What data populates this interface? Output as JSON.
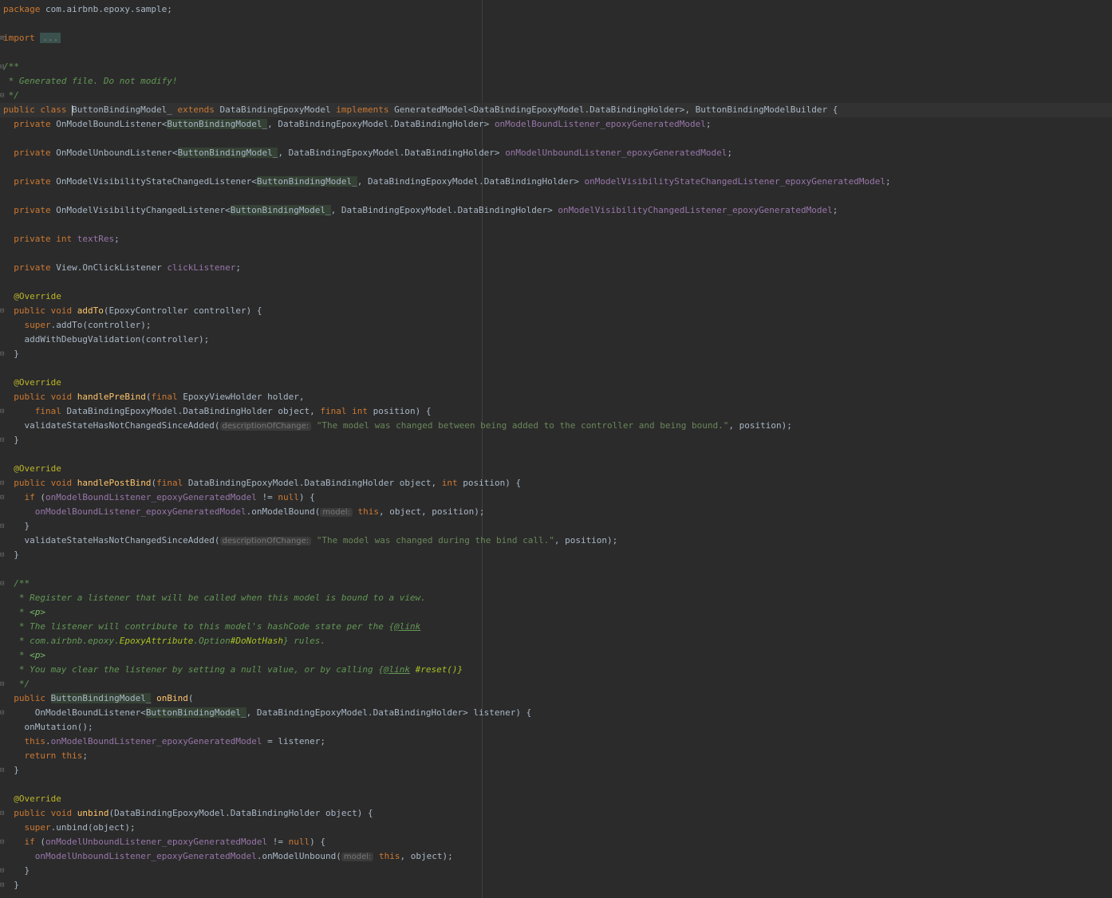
{
  "colors": {
    "background": "#2b2b2b",
    "text": "#a9b7c6",
    "keyword": "#cc7832",
    "annotation": "#bbb529",
    "field": "#9876aa",
    "method": "#ffc66d",
    "string": "#6a8759",
    "doc_comment": "#629755"
  },
  "editor": {
    "lines": [
      {
        "segments": [
          {
            "t": "package",
            "c": "kw"
          },
          {
            "t": " com.airbnb.epoxy.sample;"
          }
        ]
      },
      {
        "segments": []
      },
      {
        "fold": "⊞",
        "segments": [
          {
            "t": "import",
            "c": "kw"
          },
          {
            "t": " "
          },
          {
            "t": "...",
            "c": "fold-dots"
          }
        ]
      },
      {
        "segments": []
      },
      {
        "fold": "⊟",
        "segments": [
          {
            "t": "/**",
            "c": "cmt"
          }
        ]
      },
      {
        "segments": [
          {
            "t": " * Generated file. Do not modify!",
            "c": "cmt"
          }
        ]
      },
      {
        "fold": "⊟",
        "segments": [
          {
            "t": " */",
            "c": "cmt"
          }
        ]
      },
      {
        "current": true,
        "segments": [
          {
            "t": "public class ",
            "c": "kw"
          },
          {
            "caret": true
          },
          {
            "t": "ButtonBindingModel_"
          },
          {
            "t": " extends ",
            "c": "kw"
          },
          {
            "t": "DataBindingEpoxyModel"
          },
          {
            "t": " implements ",
            "c": "kw"
          },
          {
            "t": "GeneratedModel<DataBindingEpoxyModel.DataBindingHolder>, ButtonBindingModelBuilder {"
          }
        ]
      },
      {
        "segments": [
          {
            "t": "  "
          },
          {
            "t": "private ",
            "c": "kw"
          },
          {
            "t": "OnModelBoundListener<"
          },
          {
            "t": "ButtonBindingModel_",
            "c": "hl"
          },
          {
            "t": ", DataBindingEpoxyModel.DataBindingHolder> "
          },
          {
            "t": "onModelBoundListener_epoxyGeneratedModel",
            "c": "fld"
          },
          {
            "t": ";"
          }
        ]
      },
      {
        "segments": []
      },
      {
        "segments": [
          {
            "t": "  "
          },
          {
            "t": "private ",
            "c": "kw"
          },
          {
            "t": "OnModelUnboundListener<"
          },
          {
            "t": "ButtonBindingModel_",
            "c": "hl"
          },
          {
            "t": ", DataBindingEpoxyModel.DataBindingHolder> "
          },
          {
            "t": "onModelUnboundListener_epoxyGeneratedModel",
            "c": "fld"
          },
          {
            "t": ";"
          }
        ]
      },
      {
        "segments": []
      },
      {
        "segments": [
          {
            "t": "  "
          },
          {
            "t": "private ",
            "c": "kw"
          },
          {
            "t": "OnModelVisibilityStateChangedListener<"
          },
          {
            "t": "ButtonBindingModel_",
            "c": "hl"
          },
          {
            "t": ", DataBindingEpoxyModel.DataBindingHolder> "
          },
          {
            "t": "onModelVisibilityStateChangedListener_epoxyGeneratedModel",
            "c": "fld"
          },
          {
            "t": ";"
          }
        ]
      },
      {
        "segments": []
      },
      {
        "segments": [
          {
            "t": "  "
          },
          {
            "t": "private ",
            "c": "kw"
          },
          {
            "t": "OnModelVisibilityChangedListener<"
          },
          {
            "t": "ButtonBindingModel_",
            "c": "hl"
          },
          {
            "t": ", DataBindingEpoxyModel.DataBindingHolder> "
          },
          {
            "t": "onModelVisibilityChangedListener_epoxyGeneratedModel",
            "c": "fld"
          },
          {
            "t": ";"
          }
        ]
      },
      {
        "segments": []
      },
      {
        "segments": [
          {
            "t": "  "
          },
          {
            "t": "private int ",
            "c": "kw"
          },
          {
            "t": "textRes",
            "c": "fld"
          },
          {
            "t": ";"
          }
        ]
      },
      {
        "segments": []
      },
      {
        "segments": [
          {
            "t": "  "
          },
          {
            "t": "private ",
            "c": "kw"
          },
          {
            "t": "View.OnClickListener "
          },
          {
            "t": "clickListener",
            "c": "fld"
          },
          {
            "t": ";"
          }
        ]
      },
      {
        "segments": []
      },
      {
        "segments": [
          {
            "t": "  "
          },
          {
            "t": "@Override",
            "c": "ann"
          }
        ]
      },
      {
        "fold": "⊟",
        "segments": [
          {
            "t": "  "
          },
          {
            "t": "public void ",
            "c": "kw"
          },
          {
            "t": "addTo",
            "c": "mth"
          },
          {
            "t": "(EpoxyController controller) {"
          }
        ]
      },
      {
        "segments": [
          {
            "t": "    "
          },
          {
            "t": "super",
            "c": "kw"
          },
          {
            "t": ".addTo(controller);"
          }
        ]
      },
      {
        "segments": [
          {
            "t": "    addWithDebugValidation(controller);"
          }
        ]
      },
      {
        "fold": "⊟",
        "segments": [
          {
            "t": "  }"
          }
        ]
      },
      {
        "segments": []
      },
      {
        "segments": [
          {
            "t": "  "
          },
          {
            "t": "@Override",
            "c": "ann"
          }
        ]
      },
      {
        "segments": [
          {
            "t": "  "
          },
          {
            "t": "public void ",
            "c": "kw"
          },
          {
            "t": "handlePreBind",
            "c": "mth"
          },
          {
            "t": "("
          },
          {
            "t": "final ",
            "c": "kw"
          },
          {
            "t": "EpoxyViewHolder holder,"
          }
        ]
      },
      {
        "fold": "⊟",
        "segments": [
          {
            "t": "      "
          },
          {
            "t": "final ",
            "c": "kw"
          },
          {
            "t": "DataBindingEpoxyModel.DataBindingHolder object, "
          },
          {
            "t": "final int ",
            "c": "kw"
          },
          {
            "t": "position) {"
          }
        ]
      },
      {
        "segments": [
          {
            "t": "    validateStateHasNotChangedSinceAdded("
          },
          {
            "t": "descriptionOfChange:",
            "c": "hint"
          },
          {
            "t": " "
          },
          {
            "t": "\"The model was changed between being added to the controller and being bound.\"",
            "c": "str"
          },
          {
            "t": ", position);"
          }
        ]
      },
      {
        "fold": "⊟",
        "segments": [
          {
            "t": "  }"
          }
        ]
      },
      {
        "segments": []
      },
      {
        "segments": [
          {
            "t": "  "
          },
          {
            "t": "@Override",
            "c": "ann"
          }
        ]
      },
      {
        "fold": "⊟",
        "segments": [
          {
            "t": "  "
          },
          {
            "t": "public void ",
            "c": "kw"
          },
          {
            "t": "handlePostBind",
            "c": "mth"
          },
          {
            "t": "("
          },
          {
            "t": "final ",
            "c": "kw"
          },
          {
            "t": "DataBindingEpoxyModel.DataBindingHolder object, "
          },
          {
            "t": "int ",
            "c": "kw"
          },
          {
            "t": "position) {"
          }
        ]
      },
      {
        "fold": "⊟",
        "segments": [
          {
            "t": "    "
          },
          {
            "t": "if ",
            "c": "kw"
          },
          {
            "t": "("
          },
          {
            "t": "onModelBoundListener_epoxyGeneratedModel",
            "c": "fld"
          },
          {
            "t": " != "
          },
          {
            "t": "null",
            "c": "kw"
          },
          {
            "t": ") {"
          }
        ]
      },
      {
        "segments": [
          {
            "t": "      "
          },
          {
            "t": "onModelBoundListener_epoxyGeneratedModel",
            "c": "fld"
          },
          {
            "t": ".onModelBound("
          },
          {
            "t": "model:",
            "c": "hint"
          },
          {
            "t": " "
          },
          {
            "t": "this",
            "c": "kw"
          },
          {
            "t": ", object, position);"
          }
        ]
      },
      {
        "fold": "⊟",
        "segments": [
          {
            "t": "    }"
          }
        ]
      },
      {
        "segments": [
          {
            "t": "    validateStateHasNotChangedSinceAdded("
          },
          {
            "t": "descriptionOfChange:",
            "c": "hint"
          },
          {
            "t": " "
          },
          {
            "t": "\"The model was changed during the bind call.\"",
            "c": "str"
          },
          {
            "t": ", position);"
          }
        ]
      },
      {
        "fold": "⊟",
        "segments": [
          {
            "t": "  }"
          }
        ]
      },
      {
        "segments": []
      },
      {
        "fold": "⊟",
        "segments": [
          {
            "t": "  /**",
            "c": "cmt"
          }
        ]
      },
      {
        "segments": [
          {
            "t": "   * Register a listener that will be called when this model is bound to a view.",
            "c": "cmt"
          }
        ]
      },
      {
        "segments": [
          {
            "t": "   * ",
            "c": "cmt"
          },
          {
            "t": "<p>",
            "c": "cmttag"
          }
        ]
      },
      {
        "segments": [
          {
            "t": "   * The listener will contribute to this model's hashCode state per the ",
            "c": "cmt"
          },
          {
            "t": "{",
            "c": "cmt"
          },
          {
            "t": "@link",
            "c": "cmtlink"
          }
        ]
      },
      {
        "segments": [
          {
            "t": "   * com.airbnb.epoxy.",
            "c": "cmt"
          },
          {
            "t": "EpoxyAttribute",
            "c": "cmtref"
          },
          {
            "t": ".Option",
            "c": "cmt"
          },
          {
            "t": "#DoNotHash",
            "c": "cmtref"
          },
          {
            "t": "} rules.",
            "c": "cmt"
          }
        ]
      },
      {
        "segments": [
          {
            "t": "   * ",
            "c": "cmt"
          },
          {
            "t": "<p>",
            "c": "cmttag"
          }
        ]
      },
      {
        "segments": [
          {
            "t": "   * You may clear the listener by setting a null value, or by calling ",
            "c": "cmt"
          },
          {
            "t": "{",
            "c": "cmt"
          },
          {
            "t": "@link",
            "c": "cmtlink"
          },
          {
            "t": " #reset()}",
            "c": "cmtref"
          }
        ]
      },
      {
        "fold": "⊟",
        "segments": [
          {
            "t": "   */",
            "c": "cmt"
          }
        ]
      },
      {
        "segments": [
          {
            "t": "  "
          },
          {
            "t": "public ",
            "c": "kw"
          },
          {
            "t": "ButtonBindingModel_",
            "c": "hl"
          },
          {
            "t": " "
          },
          {
            "t": "onBind",
            "c": "mth"
          },
          {
            "t": "("
          }
        ]
      },
      {
        "fold": "⊟",
        "segments": [
          {
            "t": "      OnModelBoundListener<"
          },
          {
            "t": "ButtonBindingModel_",
            "c": "hl"
          },
          {
            "t": ", DataBindingEpoxyModel.DataBindingHolder> listener) {"
          }
        ]
      },
      {
        "segments": [
          {
            "t": "    onMutation();"
          }
        ]
      },
      {
        "segments": [
          {
            "t": "    "
          },
          {
            "t": "this",
            "c": "kw"
          },
          {
            "t": "."
          },
          {
            "t": "onModelBoundListener_epoxyGeneratedModel",
            "c": "fld"
          },
          {
            "t": " = listener;"
          }
        ]
      },
      {
        "segments": [
          {
            "t": "    "
          },
          {
            "t": "return this",
            "c": "kw"
          },
          {
            "t": ";"
          }
        ]
      },
      {
        "fold": "⊟",
        "segments": [
          {
            "t": "  }"
          }
        ]
      },
      {
        "segments": []
      },
      {
        "segments": [
          {
            "t": "  "
          },
          {
            "t": "@Override",
            "c": "ann"
          }
        ]
      },
      {
        "fold": "⊟",
        "segments": [
          {
            "t": "  "
          },
          {
            "t": "public void ",
            "c": "kw"
          },
          {
            "t": "unbind",
            "c": "mth"
          },
          {
            "t": "(DataBindingEpoxyModel.DataBindingHolder object) {"
          }
        ]
      },
      {
        "segments": [
          {
            "t": "    "
          },
          {
            "t": "super",
            "c": "kw"
          },
          {
            "t": ".unbind(object);"
          }
        ]
      },
      {
        "fold": "⊟",
        "segments": [
          {
            "t": "    "
          },
          {
            "t": "if ",
            "c": "kw"
          },
          {
            "t": "("
          },
          {
            "t": "onModelUnboundListener_epoxyGeneratedModel",
            "c": "fld"
          },
          {
            "t": " != "
          },
          {
            "t": "null",
            "c": "kw"
          },
          {
            "t": ") {"
          }
        ]
      },
      {
        "segments": [
          {
            "t": "      "
          },
          {
            "t": "onModelUnboundListener_epoxyGeneratedModel",
            "c": "fld"
          },
          {
            "t": ".onModelUnbound("
          },
          {
            "t": "model:",
            "c": "hint"
          },
          {
            "t": " "
          },
          {
            "t": "this",
            "c": "kw"
          },
          {
            "t": ", object);"
          }
        ]
      },
      {
        "fold": "⊟",
        "segments": [
          {
            "t": "    }"
          }
        ]
      },
      {
        "fold": "⊟",
        "segments": [
          {
            "t": "  }"
          }
        ]
      }
    ]
  }
}
